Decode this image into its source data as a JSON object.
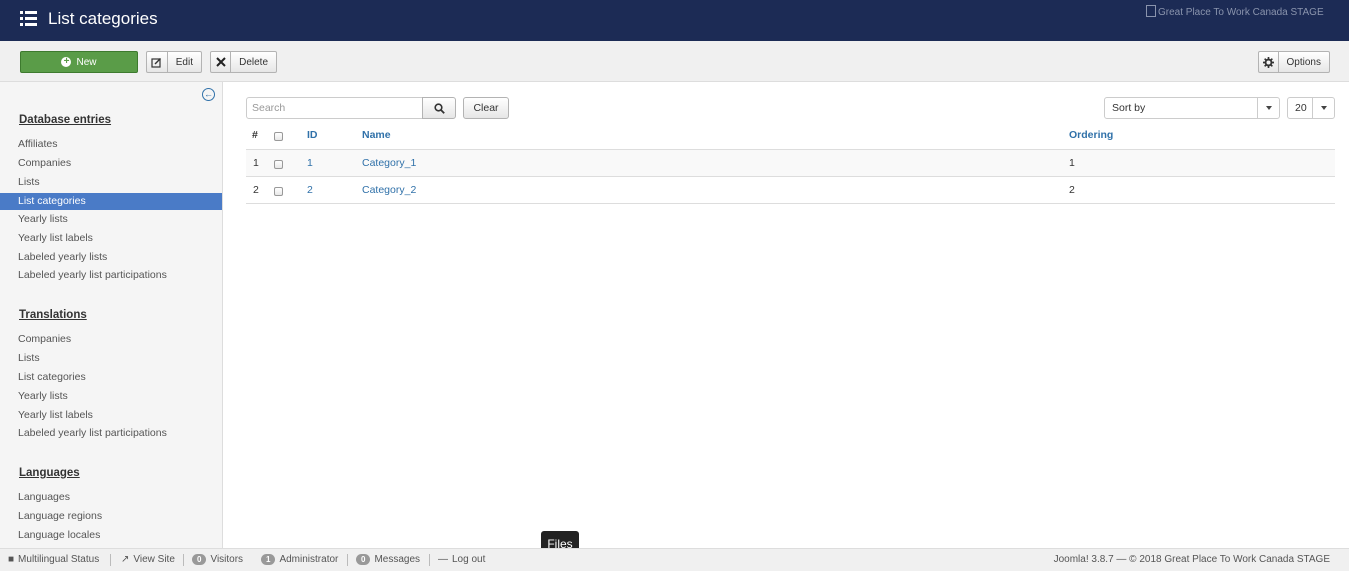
{
  "header": {
    "title": "List categories",
    "logo_alt": "Great Place To Work Canada STAGE"
  },
  "toolbar": {
    "new_label": "New",
    "edit_label": "Edit",
    "delete_label": "Delete",
    "options_label": "Options"
  },
  "sidebar": {
    "sections": [
      {
        "heading": "Database entries",
        "items": [
          "Affiliates",
          "Companies",
          "Lists",
          "List categories",
          "Yearly lists",
          "Yearly list labels",
          "Labeled yearly lists",
          "Labeled yearly list participations"
        ]
      },
      {
        "heading": "Translations",
        "items": [
          "Companies",
          "Lists",
          "List categories",
          "Yearly lists",
          "Yearly list labels",
          "Labeled yearly list participations"
        ]
      },
      {
        "heading": "Languages",
        "items": [
          "Languages",
          "Language regions",
          "Language locales"
        ]
      }
    ],
    "active_item": "List categories"
  },
  "filters": {
    "search_placeholder": "Search",
    "clear_label": "Clear",
    "sort_label": "Sort by",
    "limit_value": "20"
  },
  "table": {
    "columns": [
      "#",
      "ID",
      "Name",
      "Ordering"
    ],
    "rows": [
      {
        "num": "1",
        "id": "1",
        "name": "Category_1",
        "ordering": "1"
      },
      {
        "num": "2",
        "id": "2",
        "name": "Category_2",
        "ordering": "2"
      }
    ]
  },
  "tooltip": "Files",
  "statusbar": {
    "multilingual": "Multilingual Status",
    "view_site": "View Site",
    "visitors_count": "0",
    "visitors_label": "Visitors",
    "admin_count": "1",
    "admin_label": "Administrator",
    "messages_count": "0",
    "messages_label": "Messages",
    "logout": "Log out",
    "footer": "Joomla! 3.8.7 — © 2018 Great Place To Work Canada STAGE"
  }
}
